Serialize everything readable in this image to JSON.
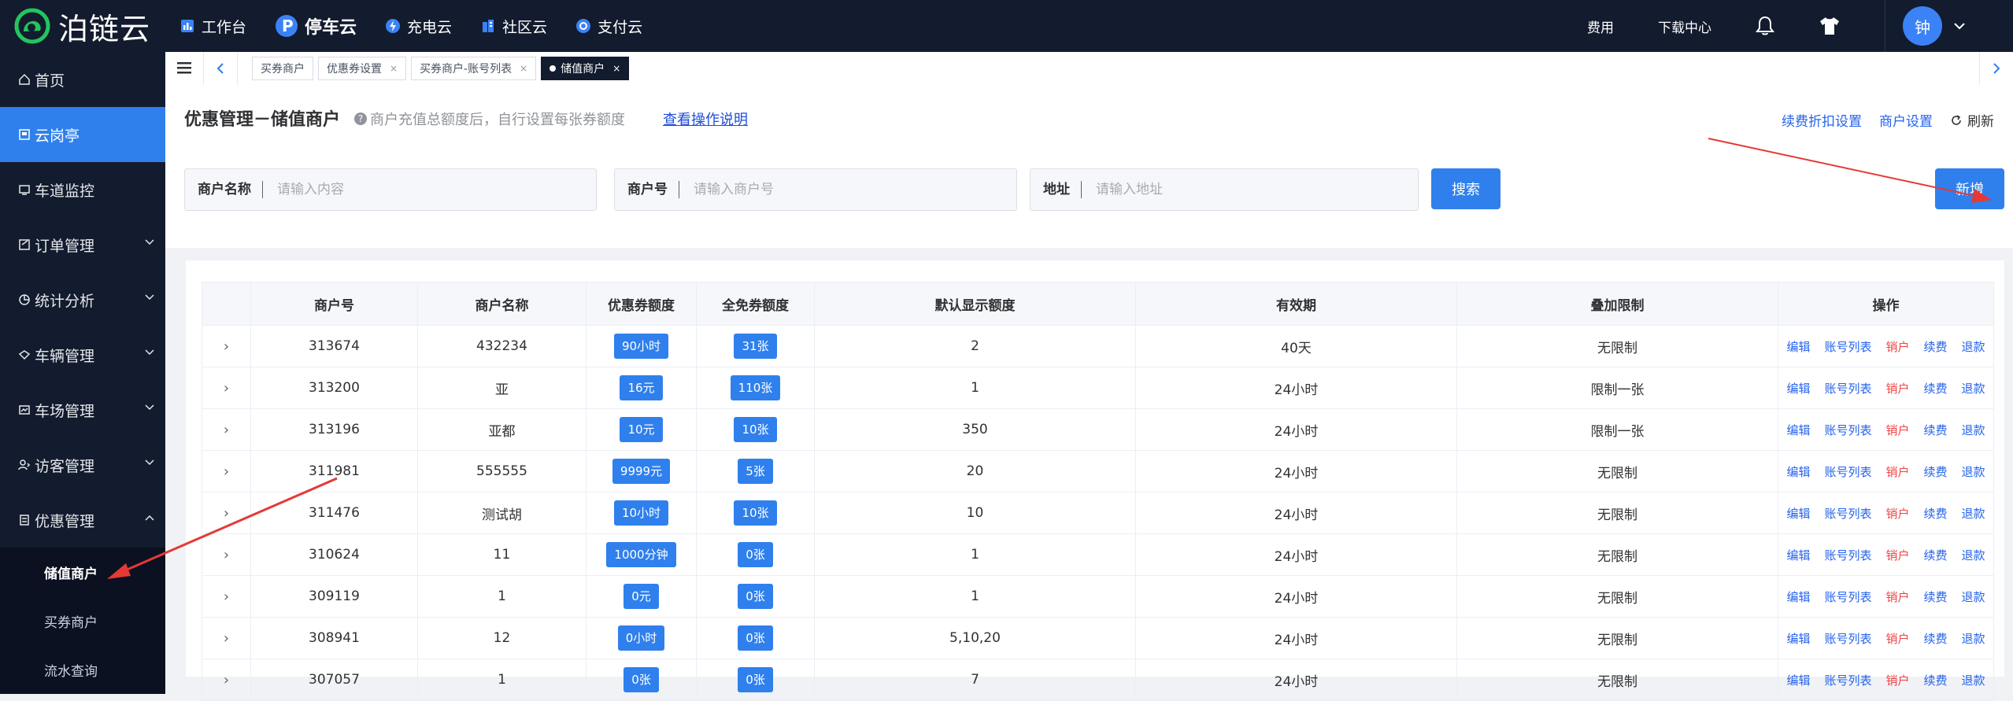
{
  "brand": {
    "name": "泊链云"
  },
  "topnav": [
    {
      "label": "工作台",
      "icon": "chart-icon"
    },
    {
      "label": "停车云",
      "icon": "parking-p-icon"
    },
    {
      "label": "充电云",
      "icon": "charging-icon"
    },
    {
      "label": "社区云",
      "icon": "building-icon"
    },
    {
      "label": "支付云",
      "icon": "payment-icon"
    }
  ],
  "topright": {
    "fees": "费用",
    "download": "下载中心",
    "avatar_text": "钟"
  },
  "sidebar": {
    "items": [
      {
        "label": "首页",
        "icon": "home-icon"
      },
      {
        "label": "云岗亭",
        "icon": "kiosk-icon"
      },
      {
        "label": "车道监控",
        "icon": "monitor-icon"
      },
      {
        "label": "订单管理",
        "icon": "order-icon"
      },
      {
        "label": "统计分析",
        "icon": "analytics-icon"
      },
      {
        "label": "车辆管理",
        "icon": "vehicle-icon"
      },
      {
        "label": "车场管理",
        "icon": "lot-icon"
      },
      {
        "label": "访客管理",
        "icon": "visitor-icon"
      },
      {
        "label": "优惠管理",
        "icon": "discount-icon"
      }
    ],
    "subitems": [
      {
        "label": "储值商户"
      },
      {
        "label": "买券商户"
      },
      {
        "label": "流水查询"
      }
    ]
  },
  "tabs": [
    {
      "label": "买券商户"
    },
    {
      "label": "优惠券设置"
    },
    {
      "label": "买券商户-账号列表"
    },
    {
      "label": "储值商户"
    }
  ],
  "page": {
    "title": "优惠管理－储值商户",
    "hint": "商户充值总额度后，自行设置每张券额度",
    "help_link": "查看操作说明",
    "actions": {
      "discount_settings": "续费折扣设置",
      "merchant_settings": "商户设置",
      "refresh": "刷新"
    }
  },
  "filters": {
    "name": {
      "label": "商户名称",
      "placeholder": "请输入内容"
    },
    "id": {
      "label": "商户号",
      "placeholder": "请输入商户号"
    },
    "address": {
      "label": "地址",
      "placeholder": "请输入地址"
    },
    "search_button": "搜索",
    "add_button": "新增"
  },
  "table": {
    "columns": [
      "商户号",
      "商户名称",
      "优惠券额度",
      "全免券额度",
      "默认显示额度",
      "有效期",
      "叠加限制",
      "操作"
    ],
    "ops": {
      "edit": "编辑",
      "accounts": "账号列表",
      "close": "销户",
      "renew": "续费",
      "refund": "退款"
    },
    "rows": [
      {
        "id": "313674",
        "name": "432234",
        "coupon": "90小时",
        "free": "31张",
        "default": "2",
        "validity": "40天",
        "limit": "无限制"
      },
      {
        "id": "313200",
        "name": "亚",
        "coupon": "16元",
        "free": "110张",
        "default": "1",
        "validity": "24小时",
        "limit": "限制一张"
      },
      {
        "id": "313196",
        "name": "亚都",
        "coupon": "10元",
        "free": "10张",
        "default": "350",
        "validity": "24小时",
        "limit": "限制一张"
      },
      {
        "id": "311981",
        "name": "555555",
        "coupon": "9999元",
        "free": "5张",
        "default": "20",
        "validity": "24小时",
        "limit": "无限制"
      },
      {
        "id": "311476",
        "name": "测试胡",
        "coupon": "10小时",
        "free": "10张",
        "default": "10",
        "validity": "24小时",
        "limit": "无限制"
      },
      {
        "id": "310624",
        "name": "11",
        "coupon": "1000分钟",
        "free": "0张",
        "default": "1",
        "validity": "24小时",
        "limit": "无限制"
      },
      {
        "id": "309119",
        "name": "1",
        "coupon": "0元",
        "free": "0张",
        "default": "1",
        "validity": "24小时",
        "limit": "无限制"
      },
      {
        "id": "308941",
        "name": "12",
        "coupon": "0小时",
        "free": "0张",
        "default": "5,10,20",
        "validity": "24小时",
        "limit": "无限制"
      },
      {
        "id": "307057",
        "name": "1",
        "coupon": "0张",
        "free": "0张",
        "default": "7",
        "validity": "24小时",
        "limit": "无限制"
      }
    ]
  },
  "colors": {
    "accent": "#2f80ed",
    "nav_bg": "#131b2e",
    "danger": "#ef4444",
    "annotation": "#e53935"
  }
}
